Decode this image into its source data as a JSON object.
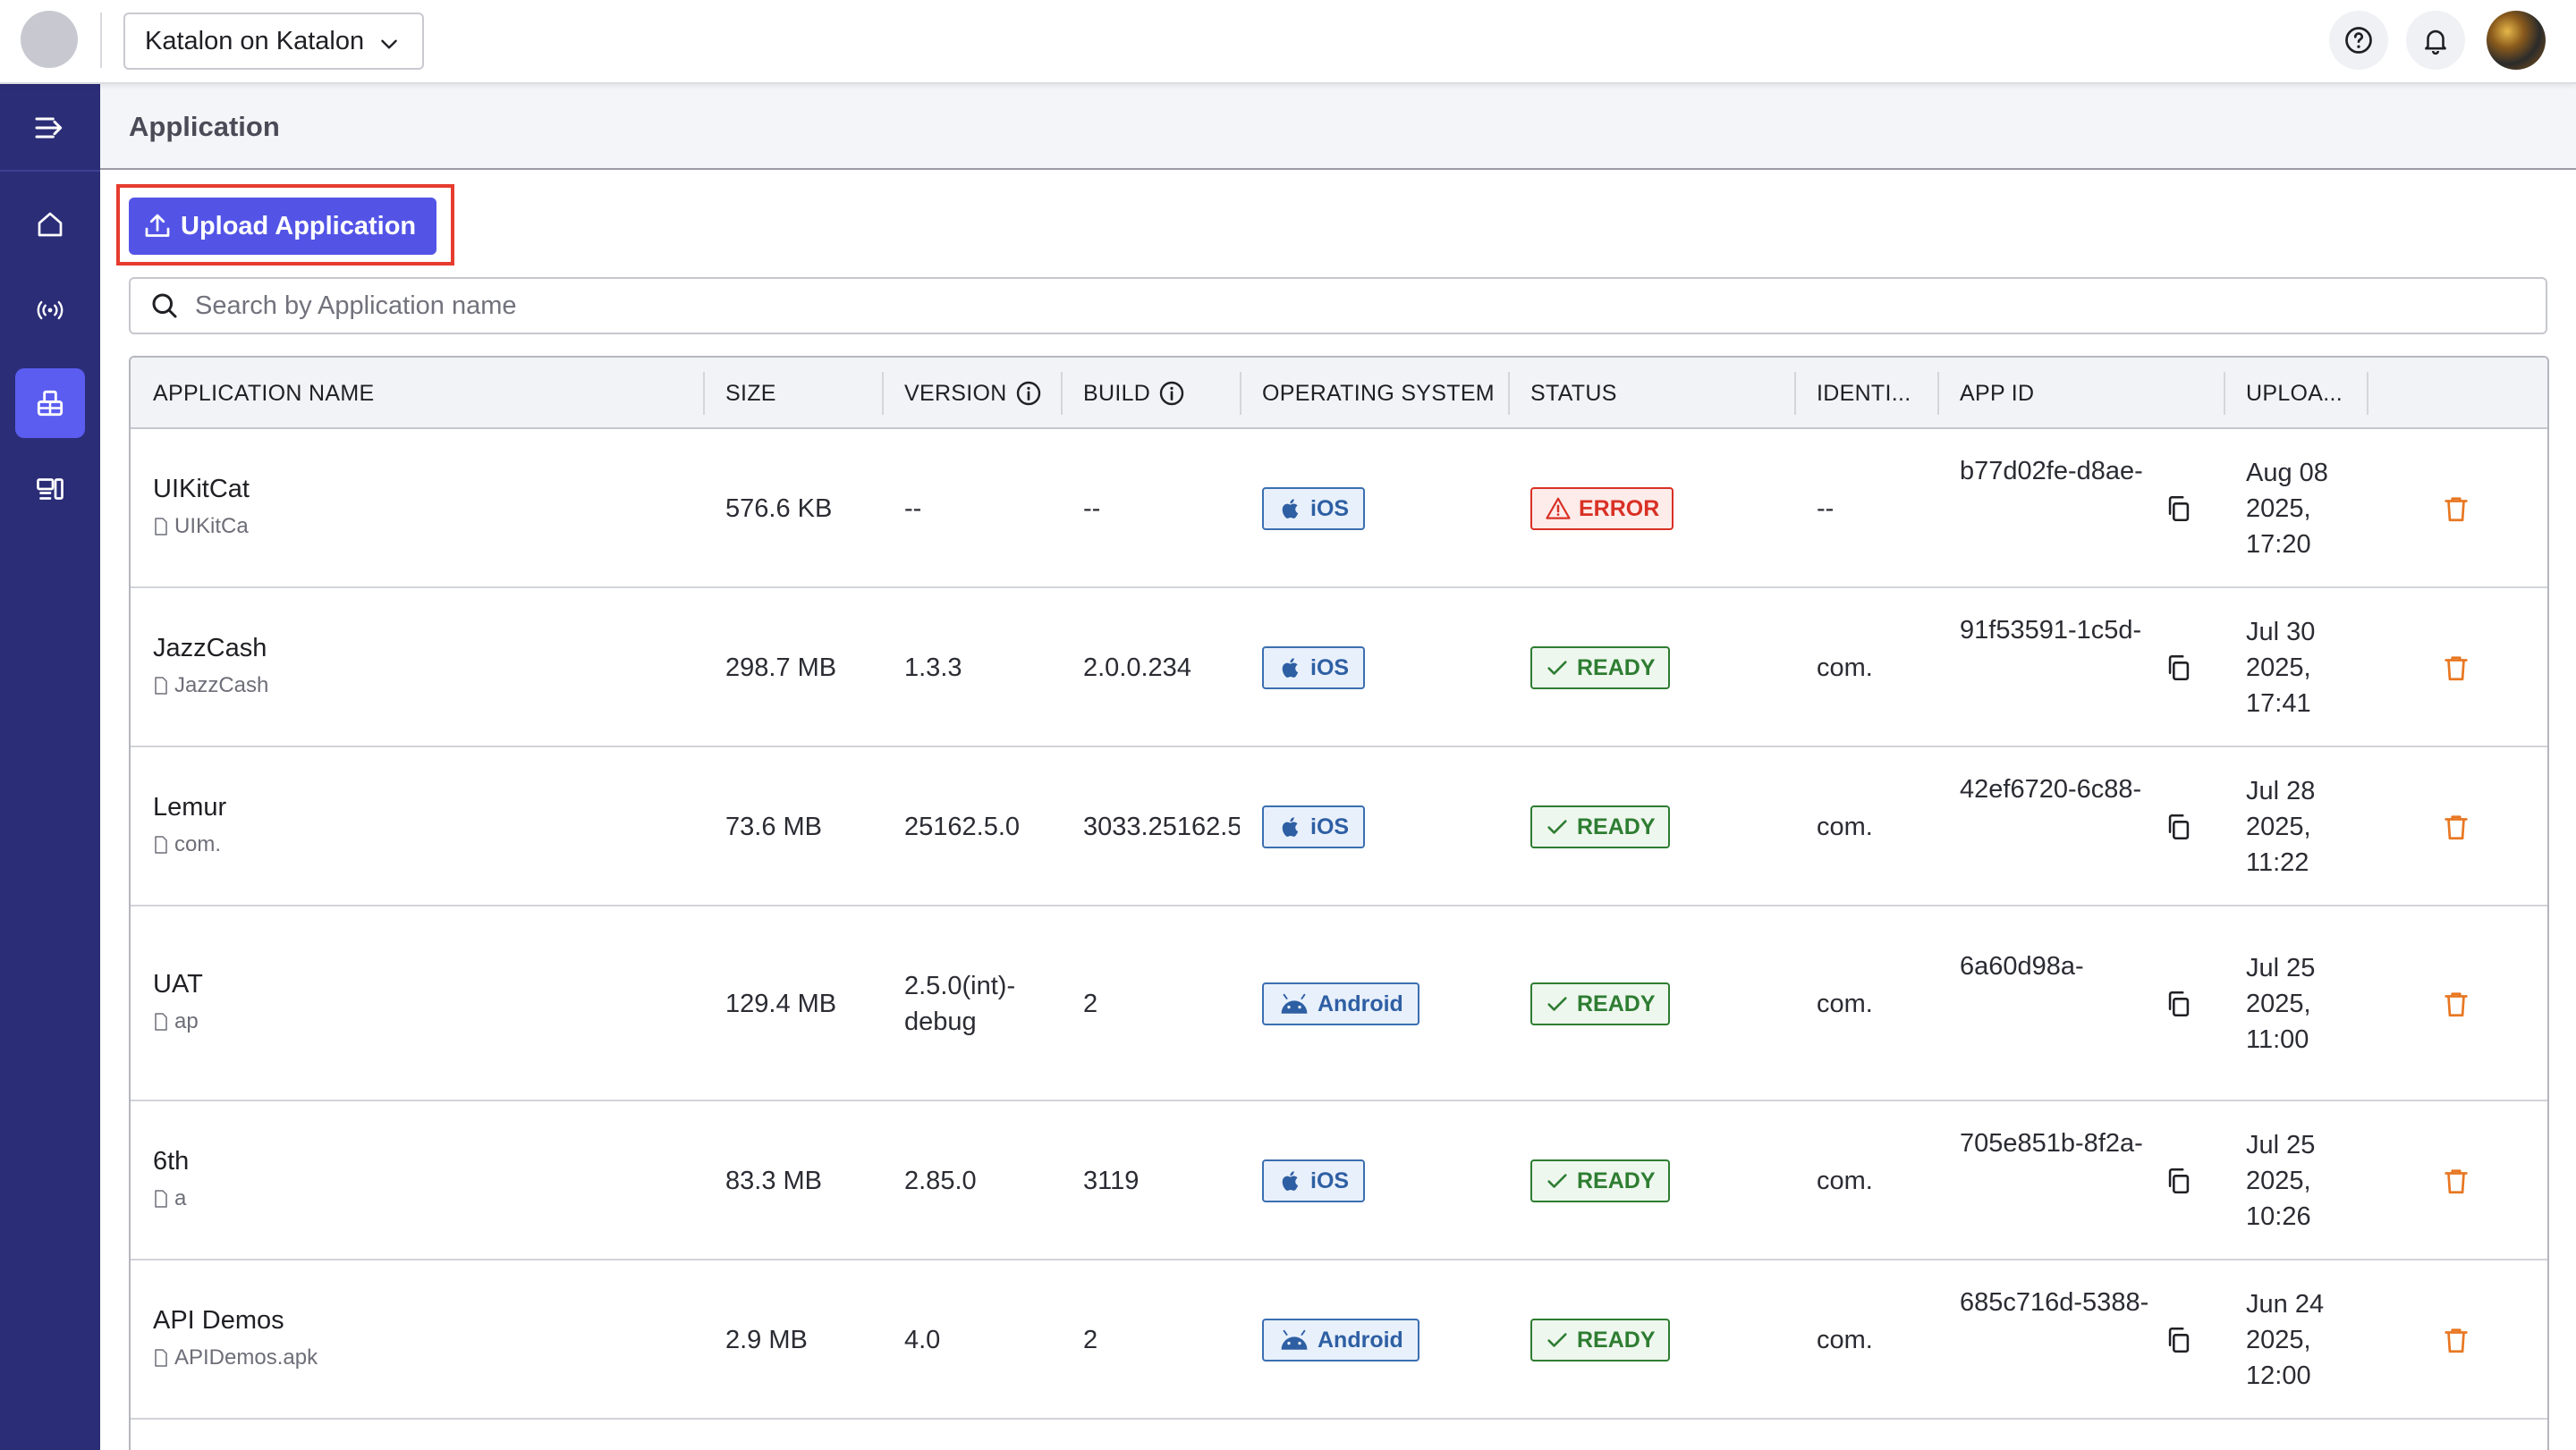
{
  "topbar": {
    "project_name": "Katalon on Katalon"
  },
  "page": {
    "title": "Application",
    "upload_label": "Upload Application",
    "search_placeholder": "Search by Application name"
  },
  "table": {
    "headers": {
      "name": "APPLICATION NAME",
      "size": "SIZE",
      "version": "VERSION",
      "build": "BUILD",
      "os": "OPERATING SYSTEM",
      "status": "STATUS",
      "identifier": "IDENTI...",
      "app_id": "APP ID",
      "uploaded": "UPLOA..."
    },
    "rows": [
      {
        "name": "UIKitCat",
        "file": "UIKitCa",
        "size": "576.6 KB",
        "version": "--",
        "version2": "",
        "build": "--",
        "os": "iOS",
        "status": "ERROR",
        "identifier": "--",
        "app_id": "b77d02fe-d8ae-",
        "date1": "Aug 08",
        "date2": "2025,",
        "date3": "17:20"
      },
      {
        "name": "JazzCash",
        "file": "JazzCash",
        "size": "298.7 MB",
        "version": "1.3.3",
        "version2": "",
        "build": "2.0.0.234",
        "os": "iOS",
        "status": "READY",
        "identifier": "com.",
        "app_id": "91f53591-1c5d-",
        "date1": "Jul 30",
        "date2": "2025,",
        "date3": "17:41"
      },
      {
        "name": "Lemur",
        "file": "com.",
        "size": "73.6 MB",
        "version": "25162.5.0",
        "version2": "",
        "build": "3033.25162.5",
        "os": "iOS",
        "status": "READY",
        "identifier": "com.",
        "app_id": "42ef6720-6c88-",
        "date1": "Jul 28",
        "date2": "2025,",
        "date3": "11:22"
      },
      {
        "name": "UAT",
        "file": "ap",
        "size": "129.4 MB",
        "version": "2.5.0(int)-",
        "version2": "debug",
        "build": "2",
        "os": "Android",
        "status": "READY",
        "identifier": "com.",
        "app_id": "6a60d98a-",
        "date1": "Jul 25",
        "date2": "2025,",
        "date3": "11:00"
      },
      {
        "name": "6th",
        "file": "a",
        "size": "83.3 MB",
        "version": "2.85.0",
        "version2": "",
        "build": "3119",
        "os": "iOS",
        "status": "READY",
        "identifier": "com.",
        "app_id": "705e851b-8f2a-",
        "date1": "Jul 25",
        "date2": "2025,",
        "date3": "10:26"
      },
      {
        "name": "API Demos",
        "file": "APIDemos.apk",
        "size": "2.9 MB",
        "version": "4.0",
        "version2": "",
        "build": "2",
        "os": "Android",
        "status": "READY",
        "identifier": "com.",
        "app_id": "685c716d-5388-",
        "date1": "Jun 24",
        "date2": "2025,",
        "date3": "12:00"
      }
    ]
  },
  "colors": {
    "sidebar": "#2b2d77",
    "accent": "#5354e6",
    "highlight": "#e63b2e",
    "ready": "#2e7d32",
    "error": "#d93025",
    "os_badge": "#2e5fa3",
    "delete": "#e87722"
  },
  "icons": {
    "sidebar": [
      "collapse-menu-icon",
      "home-icon",
      "broadcast-icon",
      "app-repository-icon",
      "devices-icon"
    ],
    "topbar": [
      "help-icon",
      "bell-icon"
    ]
  }
}
